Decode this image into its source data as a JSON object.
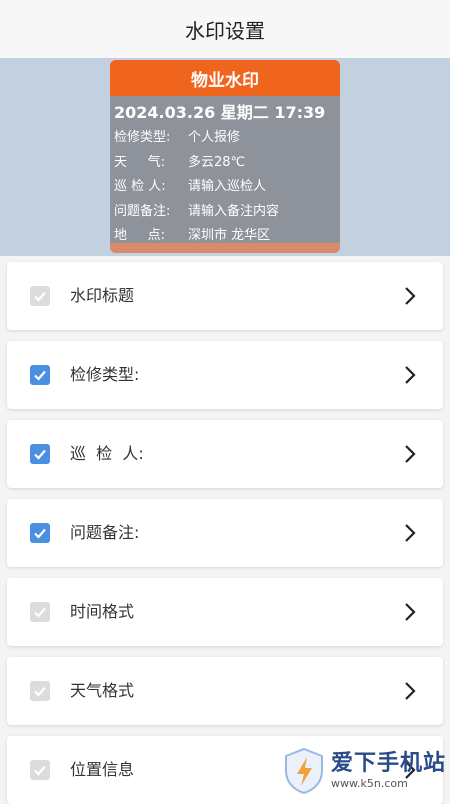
{
  "header": {
    "title": "水印设置"
  },
  "preview": {
    "card_title": "物业水印",
    "datetime": "2024.03.26 星期二 17:39",
    "rows": [
      {
        "key": "检修类型:",
        "value": "个人报修"
      },
      {
        "key": "天     气:",
        "value": "多云28℃"
      },
      {
        "key": "巡 检 人:",
        "value": "请输入巡检人"
      },
      {
        "key": "问题备注:",
        "value": "请输入备注内容"
      },
      {
        "key": "地     点:",
        "value": "深圳市 龙华区"
      }
    ],
    "colors": {
      "header": "#f0651e",
      "body": "#8d929b",
      "background": "#c3d0df"
    }
  },
  "settings": {
    "items": [
      {
        "label": "水印标题",
        "checked": true,
        "enabled": false
      },
      {
        "label": "检修类型:",
        "checked": true,
        "enabled": true
      },
      {
        "label": "巡  检  人:",
        "checked": true,
        "enabled": true
      },
      {
        "label": "问题备注:",
        "checked": true,
        "enabled": true
      },
      {
        "label": "时间格式",
        "checked": true,
        "enabled": false
      },
      {
        "label": "天气格式",
        "checked": true,
        "enabled": false
      },
      {
        "label": "位置信息",
        "checked": true,
        "enabled": false
      }
    ],
    "accent": "#4a8fe0"
  },
  "site_watermark": {
    "name": "爱下手机站",
    "url": "www.k5n.com"
  }
}
